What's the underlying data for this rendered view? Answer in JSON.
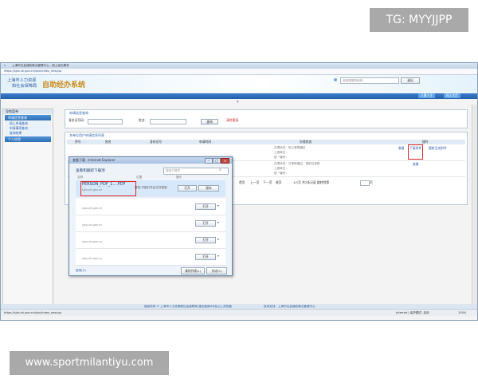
{
  "watermarks": {
    "top_right": "TG: MYYJJPP",
    "bottom_left": "www.sportmilantiyu.com"
  },
  "browser": {
    "title": "上海市社会保险事业管理中心 - 网上经办服务",
    "address": "https://sjzx.sh.gov.cn/sjzx/index_new.jsp",
    "status_url": "https://sjzx.sh.gov.cn/sjzx/index_new.jsp",
    "status_zone": "Internet | 保护模式: 启用",
    "zoom": "100%"
  },
  "banner": {
    "logo_line1": "上海市人力资源",
    "logo_line2": "和社会保障局",
    "system_name": "自助经办系统",
    "user_info": "欢迎您登录系统",
    "logout": "退出",
    "nav_btn_1": "人事人才",
    "nav_btn_2": "网上大厅"
  },
  "sidebar": {
    "header": "导航菜单",
    "items": [
      {
        "label": "申请信息查询",
        "active": true
      },
      {
        "label": "个人信息",
        "active": false
      }
    ],
    "subitems": [
      "网上申请查询",
      "申请事项查询",
      "查询结果"
    ]
  },
  "search_panel": {
    "title": "申请信息查询",
    "id_label": "身份证号码：",
    "name_label": "姓名：",
    "query_button": "查询",
    "reset_button": "清除重填"
  },
  "list_panel": {
    "title": "本单位用户申请信息列表",
    "columns": [
      "序号",
      "姓名",
      "身份证号",
      "申请时间",
      "办理状态",
      "操作"
    ],
    "rows": [
      {
        "status": "办理状态：网上受理通过",
        "unit": "上报单位：",
        "code": "统一编号：",
        "actions": [
          "查看",
          "下载附件",
          "重新生成附件"
        ]
      },
      {
        "status": "办理状态：已审核通过，请前往领取",
        "unit": "上报单位：",
        "code": "统一编号：",
        "actions": [
          "查看"
        ]
      }
    ],
    "pager": {
      "first": "首页",
      "prev": "上一页",
      "next": "下一页",
      "last": "尾页",
      "info": "1/1页 共2条记录 跳转到第",
      "page_unit": "页"
    }
  },
  "download_dialog": {
    "title": "查看下载 - Internet Explorer",
    "heading": "查看和跟踪下载项",
    "search_placeholder": "搜索下载项",
    "col_name": "名称",
    "col_location": "位置",
    "col_actions": "操作",
    "items": [
      {
        "name": "PERSON_PDF_1....PDF",
        "source": "sjzx.sh.gov.cn",
        "note": "警告:不能打开此文件类型",
        "open": "打开",
        "save": "保存"
      },
      {
        "name": "",
        "source": "sjzx.sh.gov.cn",
        "open": "打开"
      },
      {
        "name": "",
        "source": "sjzx.sh.gov.cn",
        "open": "打开"
      },
      {
        "name": "",
        "source": "sjzx.sh.gov.cn",
        "open": "打开"
      },
      {
        "name": "",
        "source": "sjzx.sh.gov.cn",
        "open": "打开"
      }
    ],
    "options": "选项(O)",
    "clear_list": "清除列表(L)",
    "close": "关闭(C)"
  },
  "footer": {
    "text": "版权所有 © 上海市人力资源和社会保障局 建议使用IE8及以上浏览器",
    "text2": "技术支持：上海市社会保险事业管理中心"
  }
}
